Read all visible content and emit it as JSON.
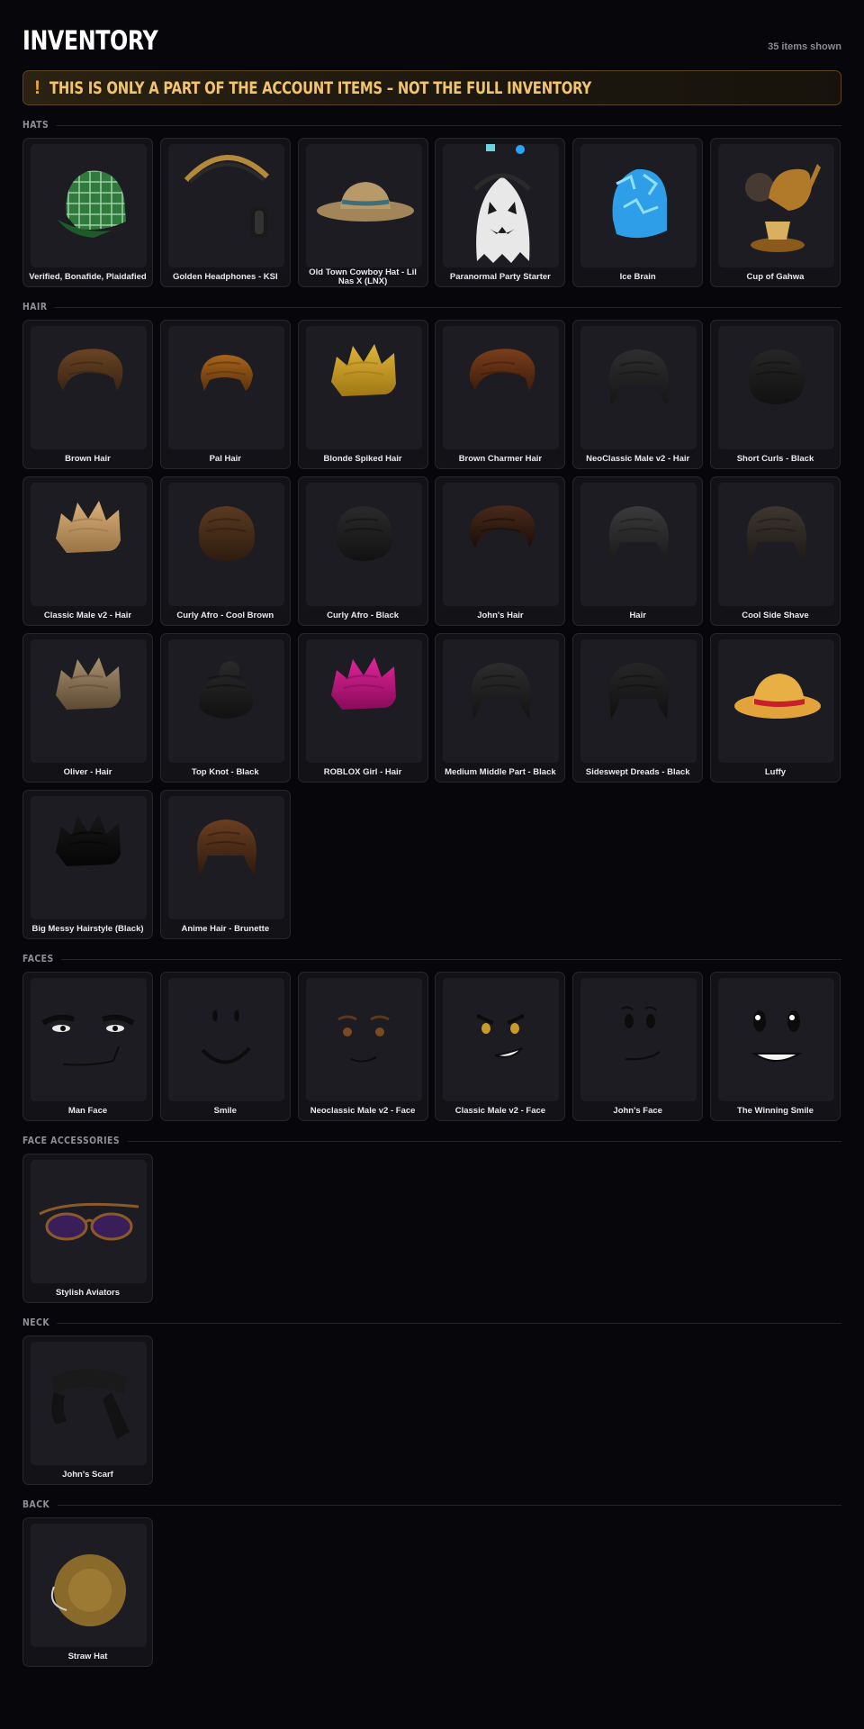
{
  "header": {
    "title": "INVENTORY",
    "count": "35 items shown"
  },
  "warning": {
    "icon": "!",
    "text": "THIS IS ONLY A PART OF THE ACCOUNT ITEMS – NOT THE FULL INVENTORY"
  },
  "sections": [
    {
      "label": "HATS",
      "items": [
        {
          "name": "Verified, Bonafide, Plaidafied",
          "icon": "plaid-cap-icon"
        },
        {
          "name": "Golden Headphones - KSI",
          "icon": "headphones-icon"
        },
        {
          "name": "Old Town Cowboy Hat - Lil Nas X (LNX)",
          "icon": "cowboy-hat-icon"
        },
        {
          "name": "Paranormal Party Starter",
          "icon": "ghost-icon"
        },
        {
          "name": "Ice Brain",
          "icon": "ice-brain-icon"
        },
        {
          "name": "Cup of Gahwa",
          "icon": "coffee-pot-icon"
        }
      ]
    },
    {
      "label": "HAIR",
      "items": [
        {
          "name": "Brown Hair",
          "icon": "hair-icon"
        },
        {
          "name": "Pal Hair",
          "icon": "hair-icon"
        },
        {
          "name": "Blonde Spiked Hair",
          "icon": "hair-icon"
        },
        {
          "name": "Brown Charmer Hair",
          "icon": "hair-icon"
        },
        {
          "name": "NeoClassic Male v2 - Hair",
          "icon": "hair-icon"
        },
        {
          "name": "Short Curls - Black",
          "icon": "hair-icon"
        },
        {
          "name": "Classic Male v2 - Hair",
          "icon": "hair-icon"
        },
        {
          "name": "Curly Afro - Cool Brown",
          "icon": "hair-icon"
        },
        {
          "name": "Curly Afro - Black",
          "icon": "hair-icon"
        },
        {
          "name": "John's Hair",
          "icon": "hair-icon"
        },
        {
          "name": "Hair",
          "icon": "hair-icon"
        },
        {
          "name": "Cool Side Shave",
          "icon": "hair-icon"
        },
        {
          "name": "Oliver - Hair",
          "icon": "hair-icon"
        },
        {
          "name": "Top Knot - Black",
          "icon": "hair-icon"
        },
        {
          "name": "ROBLOX Girl - Hair",
          "icon": "hair-icon"
        },
        {
          "name": "Medium Middle Part - Black",
          "icon": "hair-icon"
        },
        {
          "name": "Sideswept Dreads - Black",
          "icon": "hair-icon"
        },
        {
          "name": "Luffy",
          "icon": "straw-hat-icon"
        },
        {
          "name": "Big Messy Hairstyle (Black)",
          "icon": "hair-icon"
        },
        {
          "name": "Anime Hair - Brunette",
          "icon": "hair-icon"
        }
      ]
    },
    {
      "label": "FACES",
      "items": [
        {
          "name": "Man Face",
          "icon": "face-icon"
        },
        {
          "name": "Smile",
          "icon": "face-icon"
        },
        {
          "name": "Neoclassic Male v2 - Face",
          "icon": "face-icon"
        },
        {
          "name": "Classic Male v2 - Face",
          "icon": "face-icon"
        },
        {
          "name": "John's Face",
          "icon": "face-icon"
        },
        {
          "name": "The Winning Smile",
          "icon": "face-icon"
        }
      ]
    },
    {
      "label": "FACE ACCESSORIES",
      "items": [
        {
          "name": "Stylish Aviators",
          "icon": "sunglasses-icon"
        }
      ]
    },
    {
      "label": "NECK",
      "items": [
        {
          "name": "John's Scarf",
          "icon": "scarf-icon"
        }
      ]
    },
    {
      "label": "BACK",
      "items": [
        {
          "name": "Straw Hat",
          "icon": "straw-hat-icon"
        }
      ]
    }
  ]
}
